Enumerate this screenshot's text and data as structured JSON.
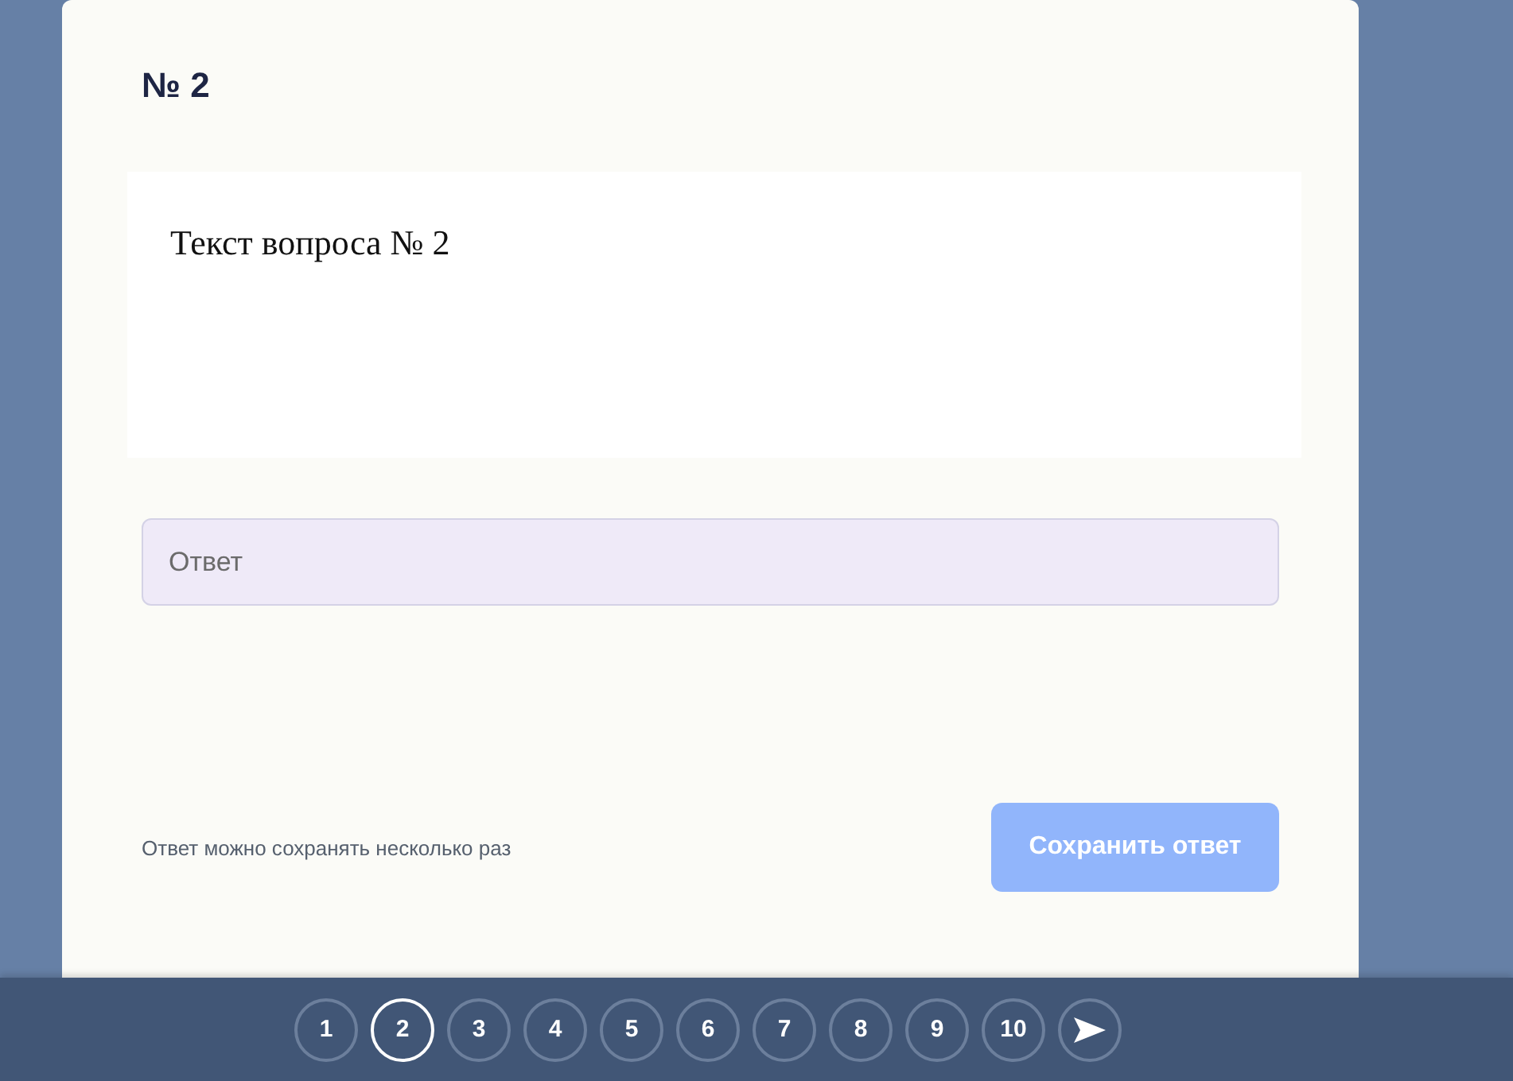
{
  "question": {
    "number": "№ 2",
    "text": "Текст вопроса № 2"
  },
  "answer": {
    "placeholder": "Ответ"
  },
  "hint": "Ответ можно сохранять несколько раз",
  "save_button": {
    "label": "Сохранить ответ",
    "disabled": true
  },
  "pages": [
    {
      "label": "1",
      "selected": false
    },
    {
      "label": "2",
      "selected": true
    },
    {
      "label": "3",
      "selected": false
    },
    {
      "label": "4",
      "selected": false
    },
    {
      "label": "5",
      "selected": false
    },
    {
      "label": "6",
      "selected": false
    },
    {
      "label": "7",
      "selected": false
    },
    {
      "label": "8",
      "selected": false
    },
    {
      "label": "9",
      "selected": false
    },
    {
      "label": "10",
      "selected": false
    }
  ]
}
